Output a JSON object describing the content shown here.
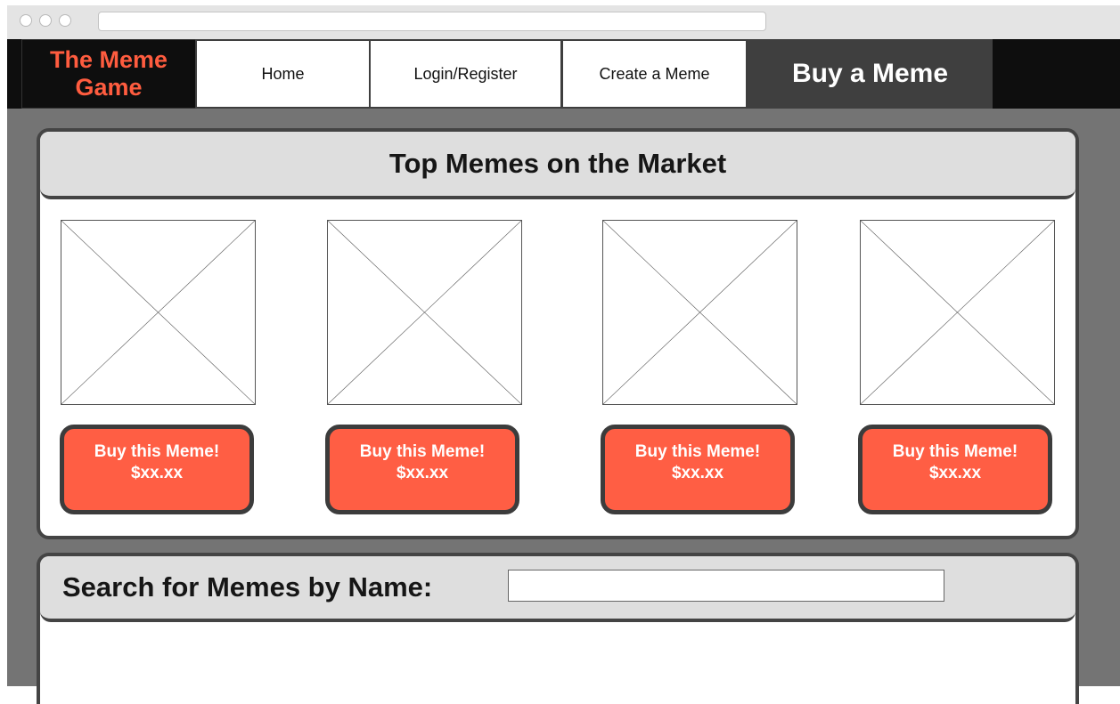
{
  "app": {
    "logo_text": "The Meme Game"
  },
  "nav": {
    "items": [
      {
        "label": "Home"
      },
      {
        "label": "Login/Register"
      },
      {
        "label": "Create a Meme"
      },
      {
        "label": "Buy a Meme",
        "active": true
      }
    ]
  },
  "top_memes": {
    "title": "Top Memes on the Market",
    "cards": [
      {
        "button_line1": "Buy this Meme!",
        "price": "$xx.xx"
      },
      {
        "button_line1": "Buy this Meme!",
        "price": "$xx.xx"
      },
      {
        "button_line1": "Buy this Meme!",
        "price": "$xx.xx"
      },
      {
        "button_line1": "Buy this Meme!",
        "price": "$xx.xx"
      }
    ]
  },
  "search": {
    "label": "Search for Memes by Name:",
    "value": "",
    "placeholder": ""
  },
  "colors": {
    "accent": "#ff5e44",
    "logo": "#ff5c3f",
    "nav_background": "#0e0e0e",
    "page_background": "#747474",
    "panel_header": "#dedede"
  },
  "icons": [
    "image-placeholder-icon"
  ]
}
